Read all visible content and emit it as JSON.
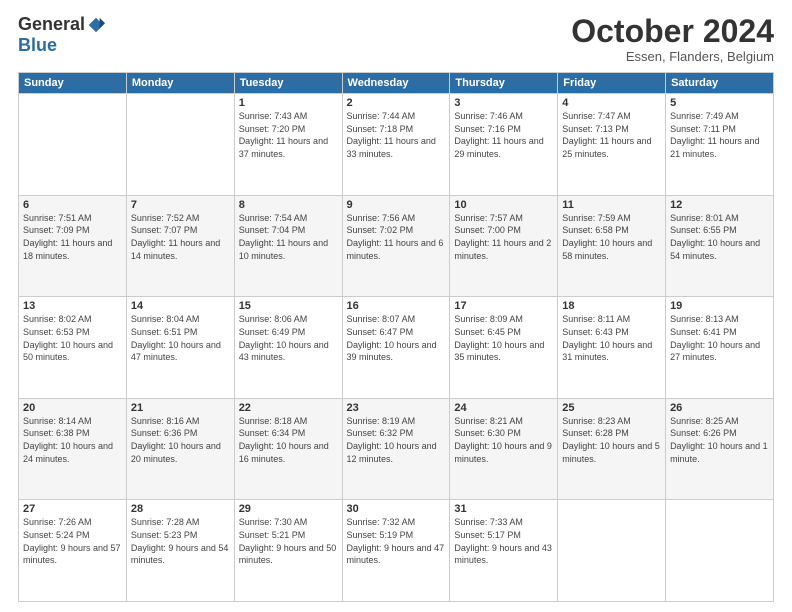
{
  "logo": {
    "general": "General",
    "blue": "Blue"
  },
  "title": "October 2024",
  "location": "Essen, Flanders, Belgium",
  "days_header": [
    "Sunday",
    "Monday",
    "Tuesday",
    "Wednesday",
    "Thursday",
    "Friday",
    "Saturday"
  ],
  "weeks": [
    [
      {
        "day": "",
        "sunrise": "",
        "sunset": "",
        "daylight": ""
      },
      {
        "day": "",
        "sunrise": "",
        "sunset": "",
        "daylight": ""
      },
      {
        "day": "1",
        "sunrise": "Sunrise: 7:43 AM",
        "sunset": "Sunset: 7:20 PM",
        "daylight": "Daylight: 11 hours and 37 minutes."
      },
      {
        "day": "2",
        "sunrise": "Sunrise: 7:44 AM",
        "sunset": "Sunset: 7:18 PM",
        "daylight": "Daylight: 11 hours and 33 minutes."
      },
      {
        "day": "3",
        "sunrise": "Sunrise: 7:46 AM",
        "sunset": "Sunset: 7:16 PM",
        "daylight": "Daylight: 11 hours and 29 minutes."
      },
      {
        "day": "4",
        "sunrise": "Sunrise: 7:47 AM",
        "sunset": "Sunset: 7:13 PM",
        "daylight": "Daylight: 11 hours and 25 minutes."
      },
      {
        "day": "5",
        "sunrise": "Sunrise: 7:49 AM",
        "sunset": "Sunset: 7:11 PM",
        "daylight": "Daylight: 11 hours and 21 minutes."
      }
    ],
    [
      {
        "day": "6",
        "sunrise": "Sunrise: 7:51 AM",
        "sunset": "Sunset: 7:09 PM",
        "daylight": "Daylight: 11 hours and 18 minutes."
      },
      {
        "day": "7",
        "sunrise": "Sunrise: 7:52 AM",
        "sunset": "Sunset: 7:07 PM",
        "daylight": "Daylight: 11 hours and 14 minutes."
      },
      {
        "day": "8",
        "sunrise": "Sunrise: 7:54 AM",
        "sunset": "Sunset: 7:04 PM",
        "daylight": "Daylight: 11 hours and 10 minutes."
      },
      {
        "day": "9",
        "sunrise": "Sunrise: 7:56 AM",
        "sunset": "Sunset: 7:02 PM",
        "daylight": "Daylight: 11 hours and 6 minutes."
      },
      {
        "day": "10",
        "sunrise": "Sunrise: 7:57 AM",
        "sunset": "Sunset: 7:00 PM",
        "daylight": "Daylight: 11 hours and 2 minutes."
      },
      {
        "day": "11",
        "sunrise": "Sunrise: 7:59 AM",
        "sunset": "Sunset: 6:58 PM",
        "daylight": "Daylight: 10 hours and 58 minutes."
      },
      {
        "day": "12",
        "sunrise": "Sunrise: 8:01 AM",
        "sunset": "Sunset: 6:55 PM",
        "daylight": "Daylight: 10 hours and 54 minutes."
      }
    ],
    [
      {
        "day": "13",
        "sunrise": "Sunrise: 8:02 AM",
        "sunset": "Sunset: 6:53 PM",
        "daylight": "Daylight: 10 hours and 50 minutes."
      },
      {
        "day": "14",
        "sunrise": "Sunrise: 8:04 AM",
        "sunset": "Sunset: 6:51 PM",
        "daylight": "Daylight: 10 hours and 47 minutes."
      },
      {
        "day": "15",
        "sunrise": "Sunrise: 8:06 AM",
        "sunset": "Sunset: 6:49 PM",
        "daylight": "Daylight: 10 hours and 43 minutes."
      },
      {
        "day": "16",
        "sunrise": "Sunrise: 8:07 AM",
        "sunset": "Sunset: 6:47 PM",
        "daylight": "Daylight: 10 hours and 39 minutes."
      },
      {
        "day": "17",
        "sunrise": "Sunrise: 8:09 AM",
        "sunset": "Sunset: 6:45 PM",
        "daylight": "Daylight: 10 hours and 35 minutes."
      },
      {
        "day": "18",
        "sunrise": "Sunrise: 8:11 AM",
        "sunset": "Sunset: 6:43 PM",
        "daylight": "Daylight: 10 hours and 31 minutes."
      },
      {
        "day": "19",
        "sunrise": "Sunrise: 8:13 AM",
        "sunset": "Sunset: 6:41 PM",
        "daylight": "Daylight: 10 hours and 27 minutes."
      }
    ],
    [
      {
        "day": "20",
        "sunrise": "Sunrise: 8:14 AM",
        "sunset": "Sunset: 6:38 PM",
        "daylight": "Daylight: 10 hours and 24 minutes."
      },
      {
        "day": "21",
        "sunrise": "Sunrise: 8:16 AM",
        "sunset": "Sunset: 6:36 PM",
        "daylight": "Daylight: 10 hours and 20 minutes."
      },
      {
        "day": "22",
        "sunrise": "Sunrise: 8:18 AM",
        "sunset": "Sunset: 6:34 PM",
        "daylight": "Daylight: 10 hours and 16 minutes."
      },
      {
        "day": "23",
        "sunrise": "Sunrise: 8:19 AM",
        "sunset": "Sunset: 6:32 PM",
        "daylight": "Daylight: 10 hours and 12 minutes."
      },
      {
        "day": "24",
        "sunrise": "Sunrise: 8:21 AM",
        "sunset": "Sunset: 6:30 PM",
        "daylight": "Daylight: 10 hours and 9 minutes."
      },
      {
        "day": "25",
        "sunrise": "Sunrise: 8:23 AM",
        "sunset": "Sunset: 6:28 PM",
        "daylight": "Daylight: 10 hours and 5 minutes."
      },
      {
        "day": "26",
        "sunrise": "Sunrise: 8:25 AM",
        "sunset": "Sunset: 6:26 PM",
        "daylight": "Daylight: 10 hours and 1 minute."
      }
    ],
    [
      {
        "day": "27",
        "sunrise": "Sunrise: 7:26 AM",
        "sunset": "Sunset: 5:24 PM",
        "daylight": "Daylight: 9 hours and 57 minutes."
      },
      {
        "day": "28",
        "sunrise": "Sunrise: 7:28 AM",
        "sunset": "Sunset: 5:23 PM",
        "daylight": "Daylight: 9 hours and 54 minutes."
      },
      {
        "day": "29",
        "sunrise": "Sunrise: 7:30 AM",
        "sunset": "Sunset: 5:21 PM",
        "daylight": "Daylight: 9 hours and 50 minutes."
      },
      {
        "day": "30",
        "sunrise": "Sunrise: 7:32 AM",
        "sunset": "Sunset: 5:19 PM",
        "daylight": "Daylight: 9 hours and 47 minutes."
      },
      {
        "day": "31",
        "sunrise": "Sunrise: 7:33 AM",
        "sunset": "Sunset: 5:17 PM",
        "daylight": "Daylight: 9 hours and 43 minutes."
      },
      {
        "day": "",
        "sunrise": "",
        "sunset": "",
        "daylight": ""
      },
      {
        "day": "",
        "sunrise": "",
        "sunset": "",
        "daylight": ""
      }
    ]
  ]
}
